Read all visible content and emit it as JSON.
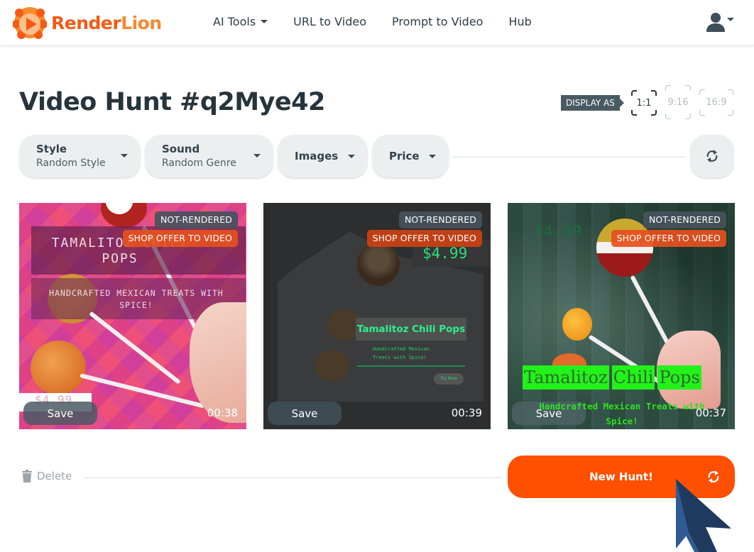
{
  "header": {
    "brand_part1": "Render",
    "brand_part2": "Lion",
    "nav": [
      {
        "label": "AI Tools",
        "has_dropdown": true
      },
      {
        "label": "URL to Video",
        "has_dropdown": false
      },
      {
        "label": "Prompt to Video",
        "has_dropdown": false
      },
      {
        "label": "Hub",
        "has_dropdown": false
      }
    ],
    "user_icon": "user-icon"
  },
  "page": {
    "title": "Video Hunt #q2Mye42",
    "display_as_label": "DISPLAY AS",
    "ratios": [
      {
        "label": "1:1",
        "active": true
      },
      {
        "label": "9:16",
        "active": false
      },
      {
        "label": "16:9",
        "active": false
      }
    ]
  },
  "filters": [
    {
      "label": "Style",
      "value": "Random Style"
    },
    {
      "label": "Sound",
      "value": "Random Genre"
    },
    {
      "label": "Images",
      "value": null
    },
    {
      "label": "Price",
      "value": null
    }
  ],
  "cards": [
    {
      "status_badge": "NOT-RENDERED",
      "action_badge": "SHOP OFFER TO VIDEO",
      "title_text": "TAMALITOZ CHILI POPS",
      "subtitle_text": "HANDCRAFTED MEXICAN TREATS WITH SPICE!",
      "price_text": "$4.99",
      "save_label": "Save",
      "duration": "00:38"
    },
    {
      "status_badge": "NOT-RENDERED",
      "action_badge": "SHOP OFFER TO VIDEO",
      "title_text": "Tamalitoz Chili Pops",
      "subtitle_line1": "Handcrafted Mexican",
      "subtitle_line2": "Treats with Spice!",
      "cta_text": "Try Now",
      "price_text": "$4.99",
      "save_label": "Save",
      "duration": "00:39"
    },
    {
      "status_badge": "NOT-RENDERED",
      "action_badge": "SHOP OFFER TO VIDEO",
      "title_words": [
        "Tamalitoz",
        "Chili",
        "Pops"
      ],
      "subtitle_text": "Handcrafted Mexican Treats with Spice!",
      "price_text": "$4.99",
      "save_label": "Save",
      "duration": "00:37"
    }
  ],
  "footer": {
    "delete_label": "Delete",
    "new_hunt_label": "New Hunt!"
  },
  "colors": {
    "brand_orange": "#ff4f00",
    "logo_dark": "#f45a14",
    "logo_light": "#f7892f",
    "text_dark": "#27343c",
    "filter_bg": "#eceff0"
  }
}
